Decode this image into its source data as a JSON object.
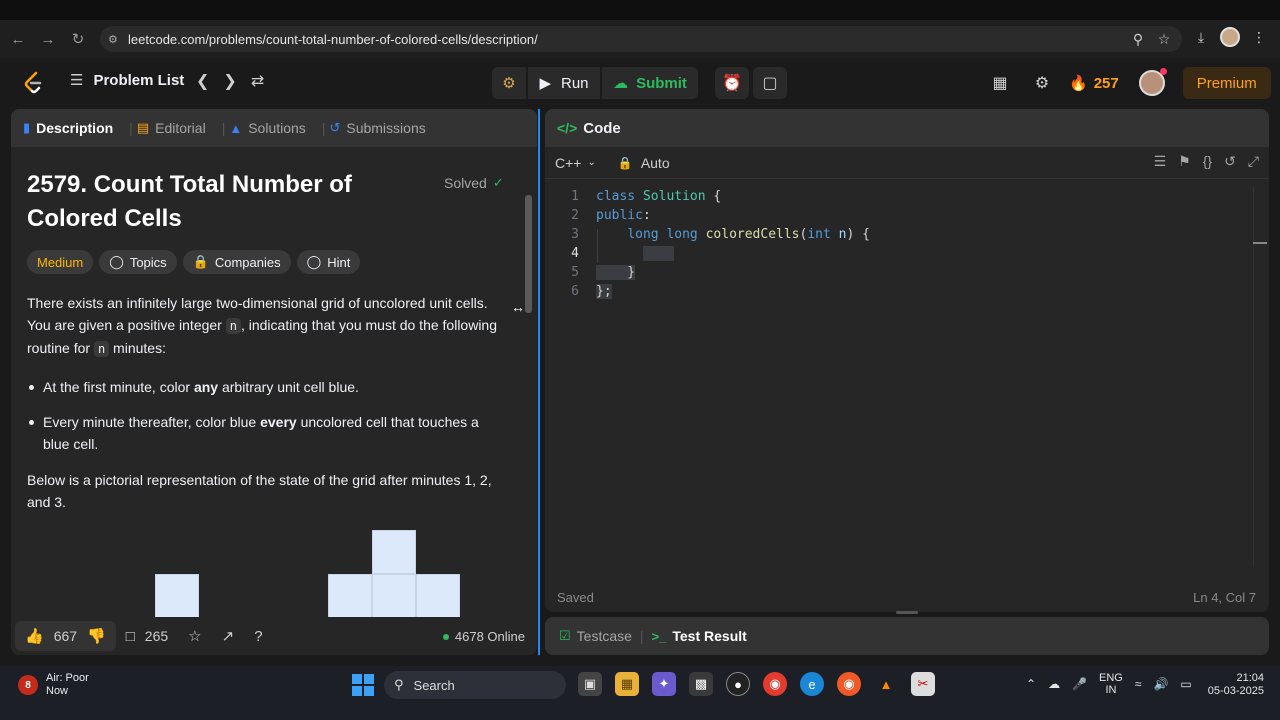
{
  "browser": {
    "url": "leetcode.com/problems/count-total-number-of-colored-cells/description/"
  },
  "nav": {
    "problem_list": "Problem List",
    "run": "Run",
    "submit": "Submit",
    "streak": "257",
    "premium": "Premium"
  },
  "left_tabs": [
    {
      "label": "Description",
      "icon": "description-icon"
    },
    {
      "label": "Editorial",
      "icon": "book-icon"
    },
    {
      "label": "Solutions",
      "icon": "flask-icon"
    },
    {
      "label": "Submissions",
      "icon": "history-icon"
    }
  ],
  "problem": {
    "title": "2579. Count Total Number of Colored Cells",
    "status": "Solved",
    "difficulty": "Medium",
    "tags": [
      "Topics",
      "Companies",
      "Hint"
    ],
    "para1_a": "There exists an infinitely large two-dimensional grid of uncolored unit cells. You are given a positive integer ",
    "para1_code1": "n",
    "para1_b": ", indicating that you must do the following routine for ",
    "para1_code2": "n",
    "para1_c": " minutes:",
    "bullet1_a": "At the first minute, color ",
    "bullet1_bold": "any",
    "bullet1_b": " arbitrary unit cell blue.",
    "bullet2_a": "Every minute thereafter, color blue ",
    "bullet2_bold": "every",
    "bullet2_b": " uncolored cell that touches a blue cell.",
    "para2": "Below is a pictorial representation of the state of the grid after minutes 1, 2, and 3."
  },
  "footer": {
    "likes": "667",
    "comments": "265",
    "online": "4678 Online"
  },
  "code": {
    "header": "Code",
    "language": "C++",
    "mode": "Auto",
    "lines": [
      "1",
      "2",
      "3",
      "4",
      "5",
      "6"
    ],
    "saved": "Saved",
    "cursor": "Ln 4, Col 7"
  },
  "bottom": {
    "testcase": "Testcase",
    "test_result": "Test Result"
  },
  "taskbar": {
    "weather_badge": "8",
    "weather_line1": "Air: Poor",
    "weather_line2": "Now",
    "search": "Search",
    "lang_line1": "ENG",
    "lang_line2": "IN",
    "time": "21:04",
    "date": "05-03-2025"
  }
}
